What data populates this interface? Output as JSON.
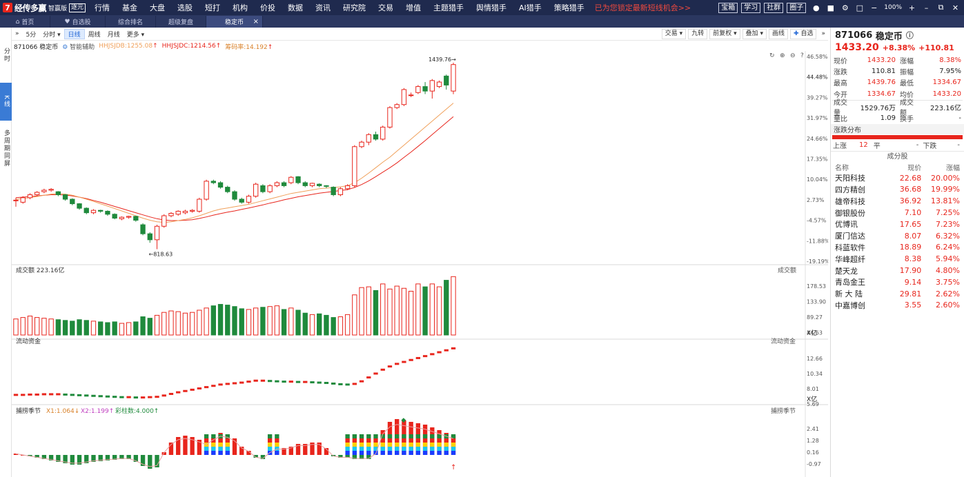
{
  "app": {
    "name": "经传多赢",
    "sub": "智赢版",
    "badge": "逐元"
  },
  "menu": [
    {
      "label": "行情",
      "dot": false
    },
    {
      "label": "基金",
      "dot": false
    },
    {
      "label": "大盘",
      "dot": false
    },
    {
      "label": "选股",
      "dot": false
    },
    {
      "label": "短打",
      "dot": false
    },
    {
      "label": "机构",
      "dot": false
    },
    {
      "label": "价投",
      "dot": false
    },
    {
      "label": "数据",
      "dot": true
    },
    {
      "label": "资讯",
      "dot": false
    },
    {
      "label": "研究院",
      "dot": false
    },
    {
      "label": "交易",
      "dot": false
    },
    {
      "label": "增值",
      "dot": false
    },
    {
      "label": "主题猎手",
      "dot": false
    },
    {
      "label": "舆情猎手",
      "dot": false
    },
    {
      "label": "AI猎手",
      "dot": false
    },
    {
      "label": "策略猎手",
      "dot": false
    }
  ],
  "promo": "已为您锁定最新短线机会>>",
  "top_right": {
    "buttons": [
      "宝箱",
      "学习",
      "社群",
      "圈子"
    ],
    "zoom": "100%"
  },
  "tabs": [
    {
      "label": "首页",
      "icon": "home-icon"
    },
    {
      "label": "自选股",
      "icon": "heart-icon"
    },
    {
      "label": "综合排名",
      "icon": ""
    },
    {
      "label": "超级复盘",
      "icon": ""
    },
    {
      "label": "稳定币",
      "icon": "",
      "active": true
    }
  ],
  "leftnav": [
    {
      "label": "分时",
      "active": false
    },
    {
      "label": "K线",
      "active": true
    },
    {
      "label": "多周期同屏",
      "active": false
    }
  ],
  "toolbar": {
    "left": [
      "5分",
      "分时",
      "日线",
      "周线",
      "月线",
      "更多"
    ],
    "active": "日线",
    "right": [
      "交易",
      "九转",
      "前复权",
      "叠加",
      "画线",
      "自选"
    ]
  },
  "legend": {
    "name": "871066 稳定币",
    "assist": "智能辅助",
    "l1": "HHJSJDB:1255.08",
    "l2": "HHJSJDC:1214.56",
    "l3": "筹码率:14.192"
  },
  "colors": {
    "up": "#e8251c",
    "down": "#1f8a3c",
    "ma1": "#f0a05a",
    "ma2": "#e8251c",
    "fund_up": "#e8251c",
    "fund_down": "#1f8a3c"
  },
  "panels": {
    "vol_title": "成交额",
    "vol_value": "223.16亿",
    "vol_right": "成交额",
    "fund_title": "流动资金",
    "fund_right": "流动资金",
    "osc_title": "捕捞季节",
    "osc_right": "捕捞季节",
    "osc_x1": "X1:1.064",
    "osc_x2": "X2:1.199",
    "osc_bar": "彩柱数:4.000",
    "unit": "X亿"
  },
  "axes": {
    "price": [
      "46.58%",
      "44.48%",
      "39.27%",
      "31.97%",
      "24.66%",
      "17.35%",
      "10.04%",
      "2.73%",
      "-4.57%",
      "-11.88%",
      "-19.19%"
    ],
    "vol": [
      "178.53",
      "133.90",
      "89.27",
      "44.63"
    ],
    "fund": [
      "12.66",
      "10.34",
      "8.01",
      "5.69"
    ],
    "osc": [
      "2.41",
      "1.28",
      "0.16",
      "-0.97"
    ]
  },
  "chart_data": {
    "type": "candlestick",
    "high_label": "1439.76",
    "low_label": "818.63",
    "price_range": [
      790,
      1460
    ],
    "candles": [
      [
        980,
        982,
        960,
        990
      ],
      [
        975,
        990,
        970,
        995
      ],
      [
        990,
        1000,
        985,
        1005
      ],
      [
        1000,
        1008,
        995,
        1012
      ],
      [
        1010,
        1015,
        1005,
        1020
      ],
      [
        1015,
        1018,
        1010,
        1022
      ],
      [
        1010,
        1000,
        995,
        1012
      ],
      [
        1000,
        985,
        980,
        1002
      ],
      [
        985,
        970,
        965,
        988
      ],
      [
        970,
        955,
        950,
        972
      ],
      [
        955,
        940,
        935,
        958
      ],
      [
        940,
        948,
        935,
        952
      ],
      [
        948,
        945,
        940,
        950
      ],
      [
        945,
        935,
        930,
        948
      ],
      [
        935,
        922,
        918,
        938
      ],
      [
        920,
        925,
        915,
        928
      ],
      [
        925,
        928,
        920,
        930
      ],
      [
        928,
        915,
        910,
        930
      ],
      [
        900,
        870,
        865,
        905
      ],
      [
        870,
        850,
        840,
        875
      ],
      [
        850,
        895,
        818.63,
        900
      ],
      [
        895,
        930,
        890,
        935
      ],
      [
        930,
        938,
        925,
        942
      ],
      [
        935,
        945,
        930,
        948
      ],
      [
        940,
        945,
        935,
        950
      ],
      [
        945,
        948,
        940,
        952
      ],
      [
        945,
        985,
        940,
        990
      ],
      [
        985,
        1045,
        980,
        1050
      ],
      [
        1045,
        1040,
        1035,
        1050
      ],
      [
        1040,
        1025,
        1020,
        1045
      ],
      [
        1025,
        1010,
        1005,
        1030
      ],
      [
        1010,
        985,
        980,
        1015
      ],
      [
        985,
        975,
        970,
        990
      ],
      [
        975,
        995,
        970,
        1000
      ],
      [
        995,
        1035,
        990,
        1040
      ],
      [
        1030,
        1010,
        1005,
        1035
      ],
      [
        1010,
        1030,
        1005,
        1035
      ],
      [
        1030,
        1040,
        1025,
        1045
      ],
      [
        1040,
        1030,
        1025,
        1045
      ],
      [
        1040,
        1058,
        1035,
        1062
      ],
      [
        1060,
        1040,
        1035,
        1062
      ],
      [
        1040,
        1030,
        1025,
        1045
      ],
      [
        1030,
        1038,
        1025,
        1040
      ],
      [
        1035,
        1030,
        1025,
        1038
      ],
      [
        1030,
        1028,
        1022,
        1032
      ],
      [
        1025,
        1000,
        995,
        1028
      ],
      [
        1000,
        1020,
        995,
        1025
      ],
      [
        1020,
        1030,
        1015,
        1035
      ],
      [
        1030,
        1160,
        1025,
        1165
      ],
      [
        1160,
        1175,
        1155,
        1180
      ],
      [
        1175,
        1200,
        1165,
        1205
      ],
      [
        1200,
        1185,
        1180,
        1210
      ],
      [
        1185,
        1225,
        1180,
        1230
      ],
      [
        1225,
        1290,
        1220,
        1295
      ],
      [
        1290,
        1300,
        1285,
        1305
      ],
      [
        1300,
        1350,
        1295,
        1355
      ],
      [
        1330,
        1332,
        1325,
        1340
      ],
      [
        1340,
        1360,
        1335,
        1365
      ],
      [
        1360,
        1345,
        1335,
        1375
      ],
      [
        1345,
        1380,
        1320,
        1385
      ],
      [
        1360,
        1375,
        1355,
        1380
      ],
      [
        1395,
        1365,
        1350,
        1400
      ],
      [
        1345,
        1433.2,
        1334.67,
        1439.76
      ]
    ],
    "ma1": [
      985,
      987,
      990,
      994,
      998,
      1002,
      1004,
      1002,
      998,
      992,
      985,
      978,
      970,
      962,
      954,
      946,
      938,
      930,
      922,
      915,
      910,
      908,
      910,
      914,
      918,
      923,
      930,
      938,
      946,
      952,
      956,
      960,
      964,
      968,
      974,
      980,
      986,
      992,
      998,
      1004,
      1008,
      1012,
      1016,
      1020,
      1022,
      1024,
      1026,
      1030,
      1040,
      1055,
      1072,
      1090,
      1108,
      1125,
      1145,
      1165,
      1185,
      1205,
      1225,
      1245,
      1265,
      1285,
      1305
    ],
    "ma2": [
      990,
      992,
      994,
      996,
      998,
      1000,
      1000,
      999,
      996,
      992,
      987,
      981,
      975,
      968,
      961,
      954,
      947,
      940,
      933,
      926,
      920,
      916,
      914,
      914,
      915,
      917,
      921,
      926,
      932,
      937,
      942,
      946,
      951,
      956,
      961,
      966,
      972,
      977,
      983,
      988,
      993,
      997,
      1001,
      1005,
      1008,
      1011,
      1014,
      1017,
      1024,
      1034,
      1046,
      1060,
      1075,
      1090,
      1106,
      1124,
      1142,
      1161,
      1180,
      1200,
      1220,
      1240,
      1260
    ],
    "volume": [
      44,
      48,
      52,
      48,
      46,
      44,
      42,
      40,
      38,
      42,
      40,
      38,
      36,
      34,
      36,
      32,
      34,
      36,
      50,
      46,
      54,
      62,
      66,
      64,
      60,
      62,
      68,
      74,
      80,
      84,
      82,
      78,
      72,
      70,
      74,
      76,
      78,
      80,
      70,
      74,
      68,
      60,
      56,
      58,
      54,
      48,
      50,
      56,
      110,
      130,
      132,
      122,
      140,
      126,
      134,
      128,
      120,
      140,
      132,
      140,
      132,
      150,
      160
    ],
    "fund": [
      5.9,
      5.9,
      5.95,
      5.95,
      6.0,
      6.0,
      6.0,
      5.95,
      5.9,
      5.85,
      5.8,
      5.75,
      5.7,
      5.65,
      5.6,
      5.55,
      5.55,
      5.5,
      5.5,
      5.55,
      5.6,
      5.8,
      6.05,
      6.3,
      6.5,
      6.7,
      6.9,
      7.1,
      7.3,
      7.5,
      7.6,
      7.7,
      7.8,
      7.95,
      8.1,
      8.1,
      8.05,
      8.0,
      7.95,
      7.95,
      7.9,
      7.9,
      7.85,
      7.8,
      7.75,
      7.65,
      7.55,
      7.5,
      7.6,
      8.0,
      8.6,
      9.2,
      9.8,
      10.3,
      10.7,
      11.0,
      11.3,
      11.6,
      11.9,
      12.2,
      12.5,
      12.8,
      13.1
    ],
    "osc": [
      0.1,
      0.0,
      -0.1,
      -0.2,
      -0.3,
      -0.4,
      -0.5,
      -0.6,
      -0.7,
      -0.7,
      -0.6,
      -0.5,
      -0.45,
      -0.4,
      -0.35,
      -0.3,
      -0.3,
      -0.5,
      -0.8,
      -1.0,
      -0.9,
      0.2,
      0.9,
      1.3,
      1.4,
      1.3,
      1.1,
      0.9,
      1.3,
      1.6,
      1.5,
      1.2,
      0.6,
      0.3,
      -0.2,
      -0.3,
      0.2,
      0.5,
      0.5,
      0.6,
      0.8,
      0.8,
      0.9,
      0.9,
      0.5,
      -0.1,
      -0.2,
      -0.2,
      -0.3,
      -0.3,
      -0.3,
      0.1,
      1.8,
      2.4,
      2.6,
      2.5,
      2.4,
      2.3,
      2.2,
      2.0,
      1.8,
      1.6,
      1.4
    ]
  },
  "sidebar": {
    "code": "871066",
    "name": "稳定币",
    "price": "1433.20",
    "pct": "+8.38%",
    "chg": "+110.81",
    "quotes": [
      [
        "现价",
        "1433.20",
        "涨幅",
        "8.38%"
      ],
      [
        "涨跌",
        "110.81",
        "振幅",
        "7.95%"
      ],
      [
        "最高",
        "1439.76",
        "最低",
        "1334.67"
      ],
      [
        "今开",
        "1334.67",
        "均价",
        "1433.20"
      ],
      [
        "成交量",
        "1529.76万",
        "成交额",
        "223.16亿"
      ],
      [
        "量比",
        "1.09",
        "换手",
        "-"
      ]
    ],
    "dist_title": "涨跌分布",
    "up_label": "上涨",
    "up_count": "12",
    "flat_label": "平",
    "flat_count": "-",
    "down_label": "下跌",
    "down_count": "-",
    "cf_title": "成分股",
    "cf_cols": [
      "名称",
      "现价",
      "涨幅"
    ],
    "cf_rows": [
      [
        "天阳科技",
        "22.68",
        "20.00%"
      ],
      [
        "四方精创",
        "36.68",
        "19.99%"
      ],
      [
        "雄帝科技",
        "36.92",
        "13.81%"
      ],
      [
        "御银股份",
        "7.10",
        "7.25%"
      ],
      [
        "优博讯",
        "17.65",
        "7.23%"
      ],
      [
        "厦门信达",
        "8.07",
        "6.32%"
      ],
      [
        "科蓝软件",
        "18.89",
        "6.24%"
      ],
      [
        "华峰超纤",
        "8.38",
        "5.94%"
      ],
      [
        "楚天龙",
        "17.90",
        "4.80%"
      ],
      [
        "青岛金王",
        "9.14",
        "3.75%"
      ],
      [
        "新 大 陆",
        "29.81",
        "2.62%"
      ],
      [
        "中嘉博创",
        "3.55",
        "2.60%"
      ]
    ]
  }
}
